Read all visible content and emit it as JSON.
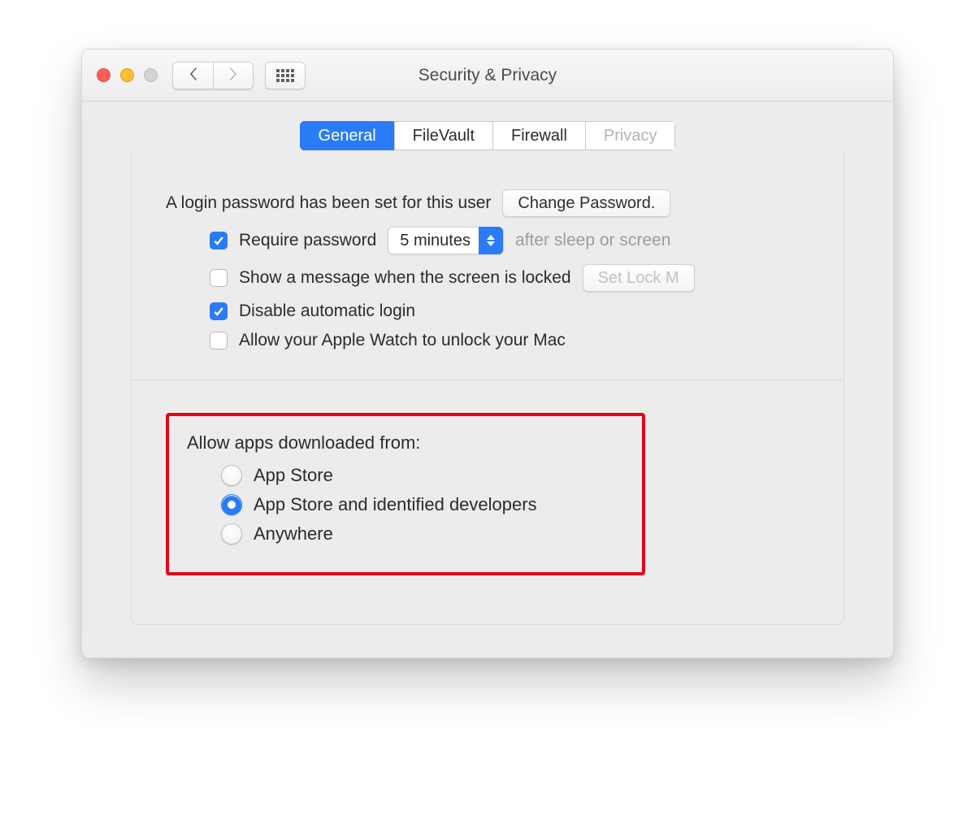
{
  "window": {
    "title": "Security & Privacy"
  },
  "tabs": {
    "general": "General",
    "filevault": "FileVault",
    "firewall": "Firewall",
    "privacy": "Privacy",
    "active": "general"
  },
  "login": {
    "password_set_text": "A login password has been set for this user",
    "change_password_button": "Change Password.",
    "require_password_label": "Require password",
    "require_password_checked": true,
    "delay_value": "5 minutes",
    "after_text": "after sleep or screen",
    "show_message_label": "Show a message when the screen is locked",
    "show_message_checked": false,
    "set_lock_button": "Set Lock M",
    "disable_auto_login_label": "Disable automatic login",
    "disable_auto_login_checked": true,
    "apple_watch_label": "Allow your Apple Watch to unlock your Mac",
    "apple_watch_checked": false
  },
  "gatekeeper": {
    "title": "Allow apps downloaded from:",
    "options": {
      "app_store": "App Store",
      "identified": "App Store and identified developers",
      "anywhere": "Anywhere"
    },
    "selected": "identified"
  }
}
